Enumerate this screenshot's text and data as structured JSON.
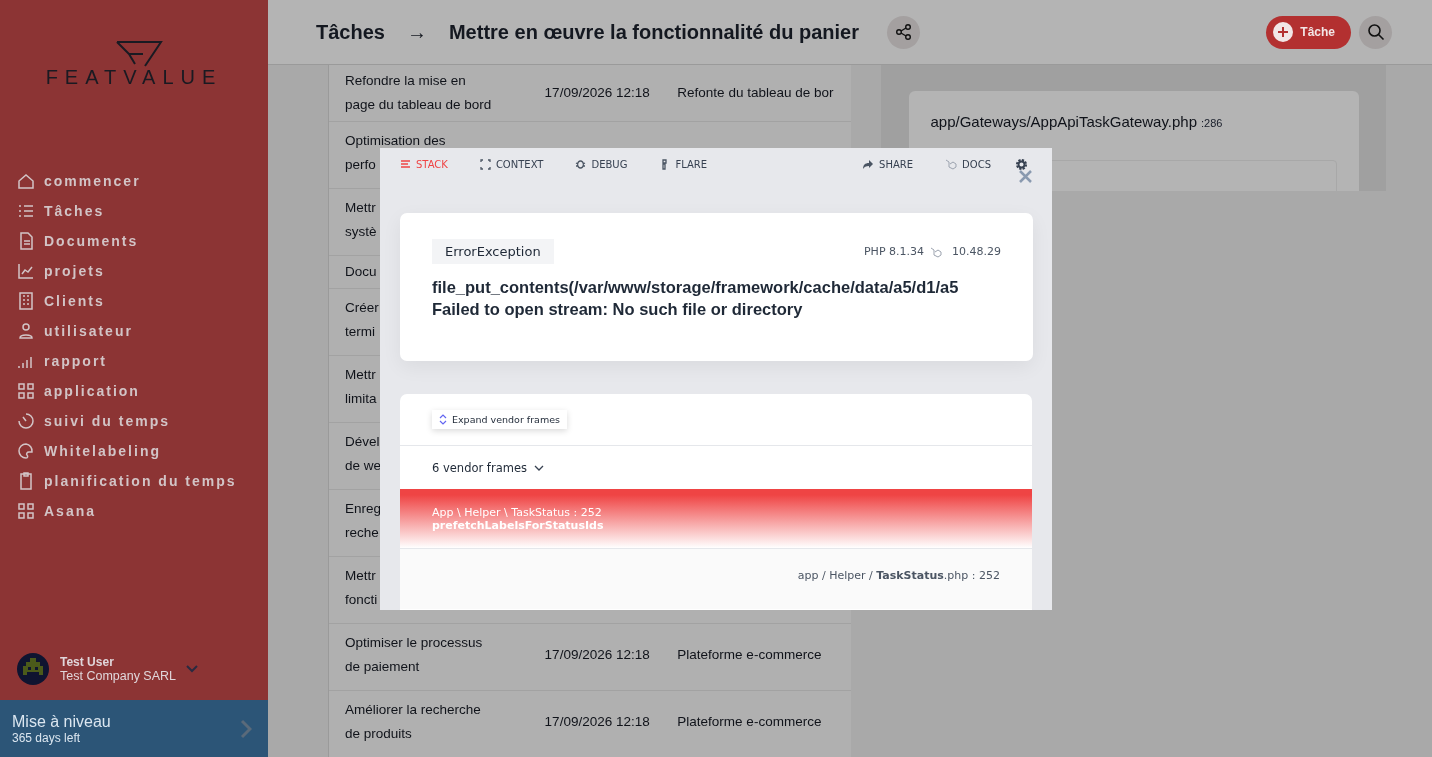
{
  "sidebar": {
    "logo": "FEATVALUE",
    "nav": [
      {
        "label": "commencer"
      },
      {
        "label": "Tâches"
      },
      {
        "label": "Documents"
      },
      {
        "label": "projets"
      },
      {
        "label": "Clients"
      },
      {
        "label": "utilisateur"
      },
      {
        "label": "rapport"
      },
      {
        "label": "application"
      },
      {
        "label": "suivi du temps"
      },
      {
        "label": "Whitelabeling"
      },
      {
        "label": "planification du temps"
      },
      {
        "label": "Asana"
      }
    ],
    "user": {
      "name": "Test User",
      "company": "Test Company SARL"
    },
    "upgrade": {
      "title": "Mise à niveau",
      "subtitle": "365 days left"
    }
  },
  "header": {
    "breadcrumb": [
      "Tâches",
      "→",
      "Mettre en œuvre la fonctionnalité du panier"
    ],
    "new_task_button": "Tâche"
  },
  "task_table": {
    "rows": [
      {
        "title_lines": [
          "Refondre la mise en",
          "page du tableau de bord"
        ],
        "date": "17/09/2026 12:18",
        "project": "Refonte du tableau de bor"
      },
      {
        "title_lines": [
          "Optimisation des",
          "perfo"
        ]
      },
      {
        "title_lines": [
          "Mettr",
          "systè"
        ]
      },
      {
        "title_lines": [
          "Docu"
        ]
      },
      {
        "title_lines": [
          "Créer",
          "termi"
        ]
      },
      {
        "title_lines": [
          "Mettr",
          "limita"
        ]
      },
      {
        "title_lines": [
          "Dével",
          "de we"
        ]
      },
      {
        "title_lines": [
          "Enreg",
          "reche"
        ]
      },
      {
        "title_lines": [
          "Mettr",
          "foncti"
        ]
      },
      {
        "title_lines": [
          "Optimiser le processus",
          "de paiement"
        ],
        "date": "17/09/2026 12:18",
        "project": "Plateforme e-commerce"
      },
      {
        "title_lines": [
          "Améliorer la recherche",
          "de produits"
        ],
        "date": "17/09/2026 12:18",
        "project": "Plateforme e-commerce"
      }
    ]
  },
  "details_panel": {
    "file": "app/Gateways/AppApiTaskGateway.php",
    "line": ":286"
  },
  "error_modal": {
    "tabs": [
      {
        "label": "STACK",
        "selected": true
      },
      {
        "label": "CONTEXT",
        "selected": false
      },
      {
        "label": "DEBUG",
        "selected": false
      },
      {
        "label": "FLARE",
        "selected": false
      }
    ],
    "actions": [
      "SHARE",
      "DOCS"
    ],
    "exception": "ErrorException",
    "php": "PHP 8.1.34",
    "framework_version": "10.48.29",
    "message_lines": [
      "file_put_contents(/var/www/storage/framework/cache/data/a5/d1/a5",
      "Failed to open stream: No such file or directory"
    ],
    "expand_button": "Expand vendor frames",
    "vendor_frames": "6 vendor frames",
    "frame": {
      "class": "App \\ Helper \\ TaskStatus : 252",
      "method": "prefetchLabelsForStatusIds"
    },
    "file_path": "app / Helper / **TaskStatus**.php : 252"
  }
}
